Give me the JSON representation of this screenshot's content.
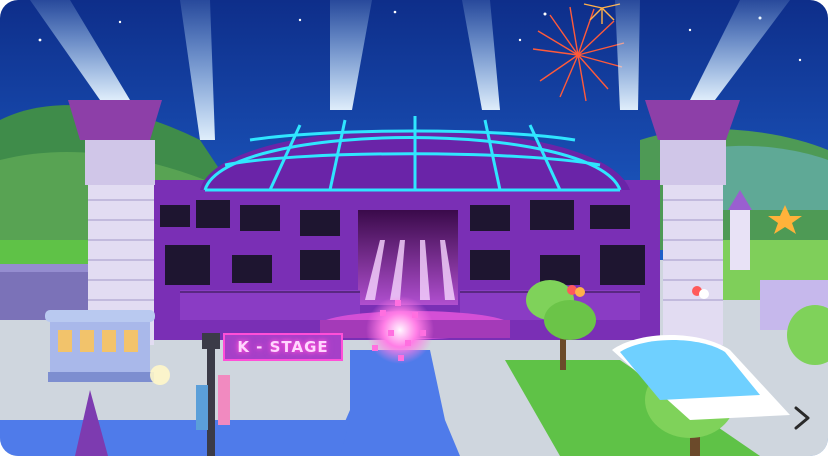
{
  "scene": {
    "stage_sign": "K - STAGE",
    "next_icon": "chevron-right-icon"
  },
  "colors": {
    "sky": "#1a4db8",
    "venue_purple": "#7a2fb5",
    "neon_cyan": "#2fe6ff",
    "neon_pink": "#ff4fd8",
    "grass": "#5fc247",
    "path_blue": "#4f7bea"
  }
}
